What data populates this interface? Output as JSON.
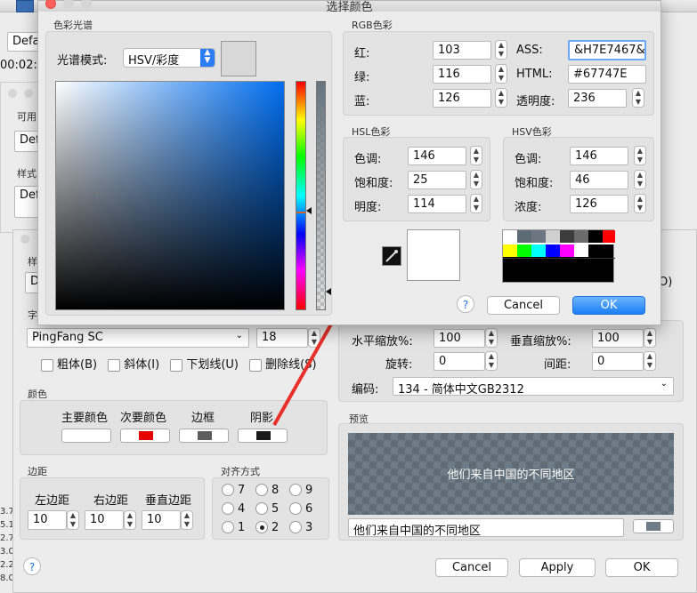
{
  "bg": {
    "left_labels": [
      "Defa",
      "00:02:",
      "可用",
      "Def",
      "样式",
      "Def",
      "样",
      "D",
      "字"
    ],
    "left_numbers": [
      "3.7",
      "5.1",
      "2.7",
      "3.0",
      "2.2",
      "8.0"
    ]
  },
  "style_editor": {
    "font_name": "PingFang SC",
    "font_size": "18",
    "checkboxes": [
      "粗体(B)",
      "斜体(I)",
      "下划线(U)",
      "删除线(S)"
    ],
    "color_group": "颜色",
    "color_labels": [
      "主要颜色",
      "次要颜色",
      "边框",
      "阴影"
    ],
    "colors": [
      "#ffffff",
      "#e60000",
      "#5c5c5c",
      "#1a1a1a"
    ],
    "margin_group": "边距",
    "margin_labels": [
      "左边距",
      "右边距",
      "垂直边距"
    ],
    "margin_values": [
      "10",
      "10",
      "10"
    ],
    "align_group": "对齐方式",
    "align_options": [
      "7",
      "8",
      "9",
      "4",
      "5",
      "6",
      "1",
      "2",
      "3"
    ],
    "align_selected": "2",
    "help": "?",
    "right_o": "O)",
    "hscale_label": "水平缩放%:",
    "hscale": "100",
    "vscale_label": "垂直缩放%:",
    "vscale": "100",
    "rotate_label": "旋转:",
    "rotate": "0",
    "spacing_label": "间距:",
    "spacing": "0",
    "encoding_label": "编码:",
    "encoding": "134 - 简体中文GB2312",
    "preview_group": "预览",
    "preview_text": "他们来自中国的不同地区",
    "preview_input": "他们来自中国的不同地区",
    "buttons": {
      "cancel": "Cancel",
      "apply": "Apply",
      "ok": "OK"
    }
  },
  "color_dialog": {
    "title": "选择颜色",
    "spectrum_group": "色彩光谱",
    "spectrum_mode_label": "光谱模式:",
    "spectrum_mode": "HSV/彩度",
    "rgb_group": "RGB色彩",
    "rgb_labels": [
      "红:",
      "绿:",
      "蓝:"
    ],
    "rgb_values": [
      "103",
      "116",
      "126"
    ],
    "ass_label": "ASS:",
    "ass_value": "&H7E7467&",
    "html_label": "HTML:",
    "html_value": "#67747E",
    "alpha_label": "透明度:",
    "alpha_value": "236",
    "hsl_group": "HSL色彩",
    "hsl_labels": [
      "色调:",
      "饱和度:",
      "明度:"
    ],
    "hsl_values": [
      "146",
      "25",
      "114"
    ],
    "hsv_group": "HSV色彩",
    "hsv_labels": [
      "色调:",
      "饱和度:",
      "浓度:"
    ],
    "hsv_values": [
      "146",
      "46",
      "126"
    ],
    "help": "?",
    "cancel": "Cancel",
    "ok": "OK",
    "current_color": "#67747E",
    "recent_colors": [
      "#ffff00",
      "#00ff00",
      "#00ffff",
      "#0000ff",
      "#ff00ff",
      "#ffffff",
      "#000000"
    ],
    "recent_top": [
      "#5d6b75",
      "#6d7680",
      "#cfcfcf",
      "#3c3c3c",
      "#6b6b6b",
      "#000000",
      "#ff0000"
    ]
  }
}
